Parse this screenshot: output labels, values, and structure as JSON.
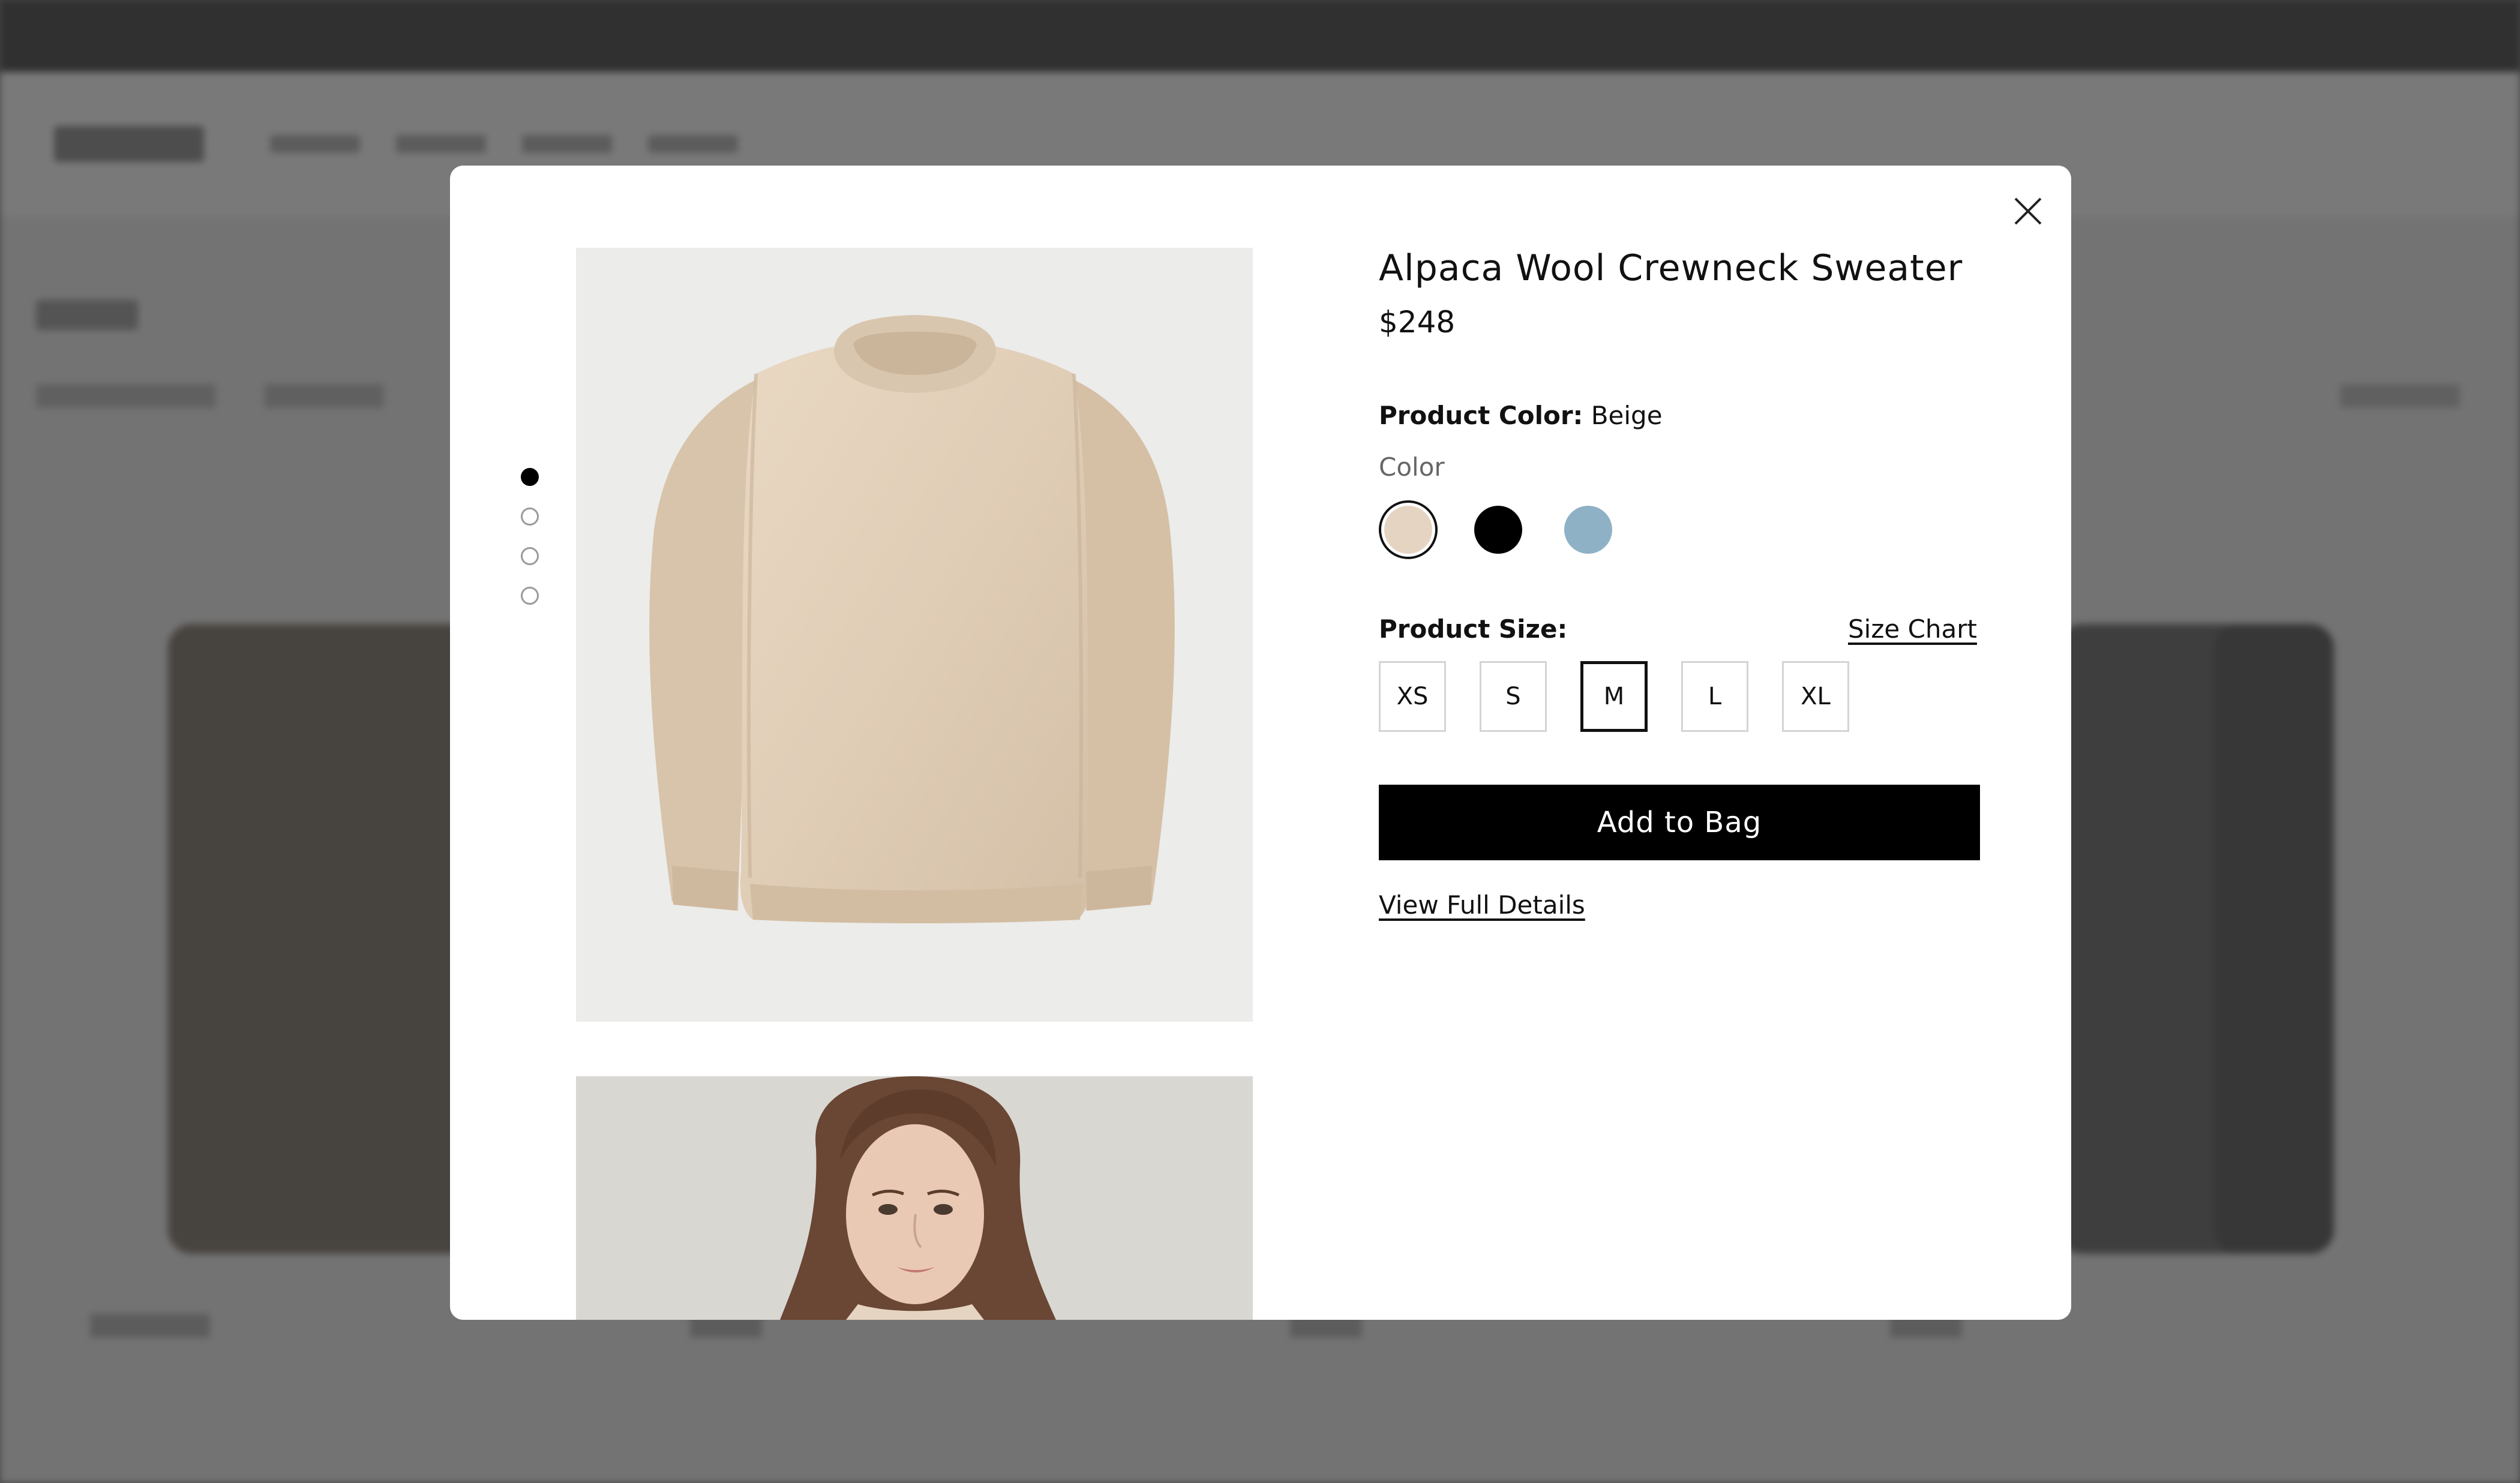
{
  "modal": {
    "close_icon": "close-icon",
    "gallery": {
      "dots": [
        {
          "active": true
        },
        {
          "active": false
        },
        {
          "active": false
        },
        {
          "active": false
        }
      ],
      "image1": "beige-crewneck-sweater-photo",
      "image2": "model-wearing-sweater-photo"
    },
    "product": {
      "title": "Alpaca Wool Crewneck Sweater",
      "price": "$248",
      "color_label": "Product Color:",
      "color_value": "Beige",
      "color_heading": "Color",
      "swatches": [
        {
          "name": "Beige",
          "hex": "#e6d4c3",
          "selected": true
        },
        {
          "name": "Black",
          "hex": "#000000",
          "selected": false
        },
        {
          "name": "Light Blue",
          "hex": "#8fb1c6",
          "selected": false
        }
      ],
      "size_label": "Product Size:",
      "size_chart_link": "Size Chart",
      "sizes": [
        "XS",
        "S",
        "M",
        "L",
        "XL"
      ],
      "selected_size": "M",
      "add_to_bag": "Add to Bag",
      "view_details": "View Full Details"
    }
  },
  "colors": {
    "overlay": "#5a5a5a",
    "sweater": "#e0cdb6",
    "button_bg": "#000000"
  }
}
